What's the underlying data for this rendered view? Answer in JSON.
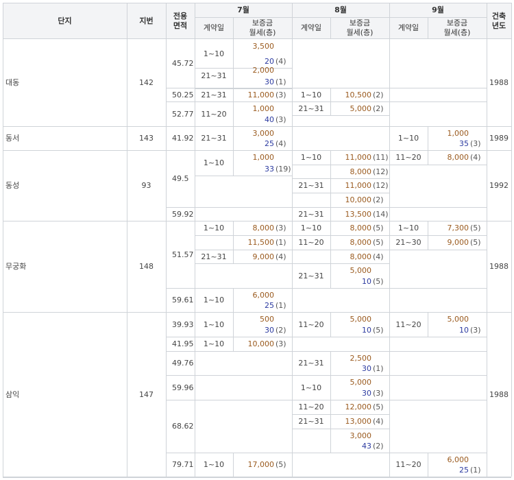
{
  "headers": {
    "danji": "단지",
    "jibeon": "지번",
    "area": [
      "전용",
      "면적"
    ],
    "months": [
      "7월",
      "8월",
      "9월"
    ],
    "contract_day": "계약일",
    "deposit_rent": [
      "보증금",
      "월세(층)"
    ],
    "built": [
      "건축",
      "년도"
    ]
  },
  "complexes": [
    {
      "name": "대동",
      "jibeon": "142",
      "built": "1988"
    },
    {
      "name": "동서",
      "jibeon": "143",
      "built": "1989"
    },
    {
      "name": "동성",
      "jibeon": "93",
      "built": "1992"
    },
    {
      "name": "무궁화",
      "jibeon": "148",
      "built": "1988"
    },
    {
      "name": "삼익",
      "jibeon": "147",
      "built": "1988"
    }
  ],
  "areas": [
    "45.72",
    "50.25",
    "52.77",
    "41.92",
    "49.5",
    "59.92",
    "51.57",
    "59.61",
    "39.93",
    "41.95",
    "49.76",
    "59.96",
    "68.62",
    "79.71"
  ],
  "entries": [
    {
      "m": 0,
      "row": [
        57,
        99
      ],
      "day": "1~10",
      "deposit": "3,500",
      "rent": "20",
      "floor": "(4)"
    },
    {
      "m": 0,
      "row": [
        92,
        129
      ],
      "day": "21~31",
      "deposit": "2,000",
      "rent": "30",
      "floor": "(1)"
    },
    {
      "m": 0,
      "row": [
        128,
        148
      ],
      "day": "21~31",
      "deposit": "11,000",
      "floor": "(3)"
    },
    {
      "m": 1,
      "row": [
        128,
        148
      ],
      "day": "1~10",
      "deposit": "10,500",
      "floor": "(2)"
    },
    {
      "m": 0,
      "row": [
        148,
        184
      ],
      "day": "11~20",
      "deposit": "1,000",
      "rent": "40",
      "floor": "(3)"
    },
    {
      "m": 1,
      "row": [
        148,
        168
      ],
      "day": "21~31",
      "deposit": "5,000",
      "floor": "(2)"
    },
    {
      "m": 0,
      "row": [
        184,
        219
      ],
      "day": "21~31",
      "deposit": "3,000",
      "rent": "25",
      "floor": "(4)"
    },
    {
      "m": 2,
      "row": [
        184,
        219
      ],
      "day": "1~10",
      "deposit": "1,000",
      "rent": "35",
      "floor": "(3)"
    },
    {
      "m": 0,
      "row": [
        219,
        256
      ],
      "day": "1~10",
      "deposit": "1,000",
      "rent": "33",
      "floor": "(19)"
    },
    {
      "m": 1,
      "row": [
        219,
        240
      ],
      "day": "1~10",
      "deposit": "11,000",
      "floor": "(11)"
    },
    {
      "m": 2,
      "row": [
        219,
        240
      ],
      "day": "11~20",
      "deposit": "8,000",
      "floor": "(4)"
    },
    {
      "m": 1,
      "row": [
        240,
        260
      ],
      "deposit": "8,000",
      "floor": "(12)"
    },
    {
      "m": 1,
      "row": [
        260,
        281
      ],
      "day": "21~31",
      "deposit": "11,000",
      "floor": "(12)"
    },
    {
      "m": 1,
      "row": [
        281,
        302
      ],
      "deposit": "10,000",
      "floor": "(2)"
    },
    {
      "m": 1,
      "row": [
        302,
        322
      ],
      "day": "21~31",
      "deposit": "13,500",
      "floor": "(14)"
    },
    {
      "m": 0,
      "row": [
        322,
        343
      ],
      "day": "1~10",
      "deposit": "8,000",
      "floor": "(3)"
    },
    {
      "m": 1,
      "row": [
        322,
        343
      ],
      "day": "1~10",
      "deposit": "8,000",
      "floor": "(5)"
    },
    {
      "m": 2,
      "row": [
        322,
        343
      ],
      "day": "1~10",
      "deposit": "7,300",
      "floor": "(5)"
    },
    {
      "m": 0,
      "row": [
        343,
        364
      ],
      "deposit": "11,500",
      "floor": "(1)"
    },
    {
      "m": 1,
      "row": [
        343,
        364
      ],
      "day": "11~20",
      "deposit": "8,000",
      "floor": "(5)"
    },
    {
      "m": 2,
      "row": [
        343,
        364
      ],
      "day": "21~30",
      "deposit": "9,000",
      "floor": "(5)"
    },
    {
      "m": 0,
      "row": [
        364,
        384
      ],
      "day": "21~31",
      "deposit": "9,000",
      "floor": "(4)"
    },
    {
      "m": 1,
      "row": [
        364,
        384
      ],
      "deposit": "8,000",
      "floor": "(4)"
    },
    {
      "m": 1,
      "row": [
        384,
        420
      ],
      "day": "21~31",
      "deposit": "5,000",
      "rent": "10",
      "floor": "(5)"
    },
    {
      "m": 0,
      "row": [
        420,
        455
      ],
      "day": "1~10",
      "deposit": "6,000",
      "rent": "25",
      "floor": "(1)"
    },
    {
      "m": 0,
      "row": [
        455,
        491
      ],
      "day": "1~10",
      "deposit": "500",
      "rent": "30",
      "floor": "(2)"
    },
    {
      "m": 1,
      "row": [
        455,
        491
      ],
      "day": "11~20",
      "deposit": "5,000",
      "rent": "10",
      "floor": "(5)"
    },
    {
      "m": 2,
      "row": [
        455,
        491
      ],
      "day": "11~20",
      "deposit": "5,000",
      "rent": "10",
      "floor": "(3)"
    },
    {
      "m": 0,
      "row": [
        491,
        512
      ],
      "day": "1~10",
      "deposit": "10,000",
      "floor": "(3)"
    },
    {
      "m": 1,
      "row": [
        512,
        547
      ],
      "day": "21~31",
      "deposit": "2,500",
      "rent": "30",
      "floor": "(1)"
    },
    {
      "m": 1,
      "row": [
        547,
        583
      ],
      "day": "1~10",
      "deposit": "5,000",
      "rent": "30",
      "floor": "(3)"
    },
    {
      "m": 1,
      "row": [
        583,
        604
      ],
      "day": "11~20",
      "deposit": "12,000",
      "floor": "(5)"
    },
    {
      "m": 1,
      "row": [
        604,
        625
      ],
      "day": "21~31",
      "deposit": "13,000",
      "floor": "(4)"
    },
    {
      "m": 1,
      "row": [
        625,
        660
      ],
      "deposit": "3,000",
      "rent": "43",
      "floor": "(2)"
    },
    {
      "m": 0,
      "row": [
        660,
        695
      ],
      "day": "1~10",
      "deposit": "17,000",
      "floor": "(5)"
    },
    {
      "m": 2,
      "row": [
        660,
        695
      ],
      "day": "11~20",
      "deposit": "6,000",
      "rent": "25",
      "floor": "(1)"
    }
  ]
}
